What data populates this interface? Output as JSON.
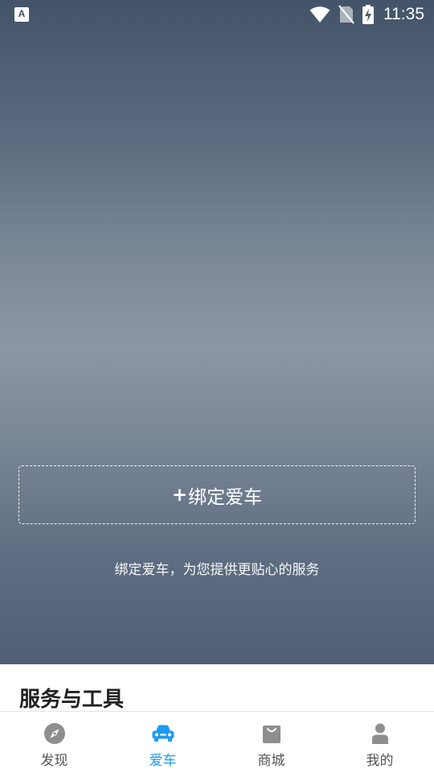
{
  "status_bar": {
    "app_icon_letter": "A",
    "time": "11:35"
  },
  "hero": {
    "bind_plus": "+",
    "bind_label": "绑定爱车",
    "tip": "绑定爱车，为您提供更贴心的服务"
  },
  "section": {
    "title": "服务与工具"
  },
  "tabbar": {
    "active_color": "#1e9bf0",
    "inactive_color": "#8e8e8e",
    "tabs": [
      {
        "label": "发现",
        "icon": "compass-icon"
      },
      {
        "label": "爱车",
        "icon": "car-icon"
      },
      {
        "label": "商城",
        "icon": "shopping-bag-icon"
      },
      {
        "label": "我的",
        "icon": "person-icon"
      }
    ]
  }
}
